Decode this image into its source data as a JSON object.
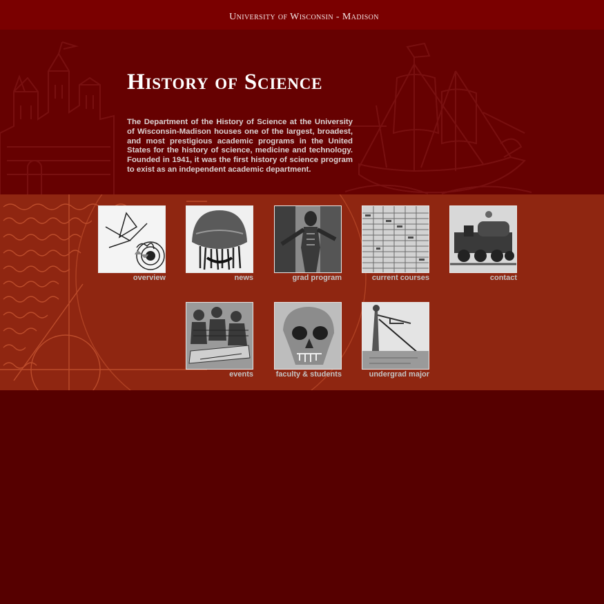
{
  "header": {
    "university": "University of Wisconsin - Madison"
  },
  "hero": {
    "title": "History of Science",
    "intro": "The Department of the History of Science at the University of Wisconsin-Madison houses one of the largest, broadest, and most prestigious academic programs in the United States for the history of science, medicine and technology. Founded in 1941, it was the first history of science program to exist as an independent academic department."
  },
  "nav": [
    {
      "label": "overview",
      "icon": "astronomical-diagram-icon"
    },
    {
      "label": "news",
      "icon": "jellyfish-icon"
    },
    {
      "label": "grad program",
      "icon": "anatomy-figure-icon"
    },
    {
      "label": "current courses",
      "icon": "ledger-table-icon"
    },
    {
      "label": "contact",
      "icon": "locomotive-icon"
    },
    {
      "label": "events",
      "icon": "dissection-scene-icon"
    },
    {
      "label": "faculty & students",
      "icon": "skull-icon"
    },
    {
      "label": "undergrad major",
      "icon": "surveyor-icon"
    }
  ],
  "colors": {
    "top_bar": "#7a0000",
    "hero": "#660101",
    "nav_band": "#8f2611",
    "page": "#560000",
    "label": "#c4c4c4"
  }
}
